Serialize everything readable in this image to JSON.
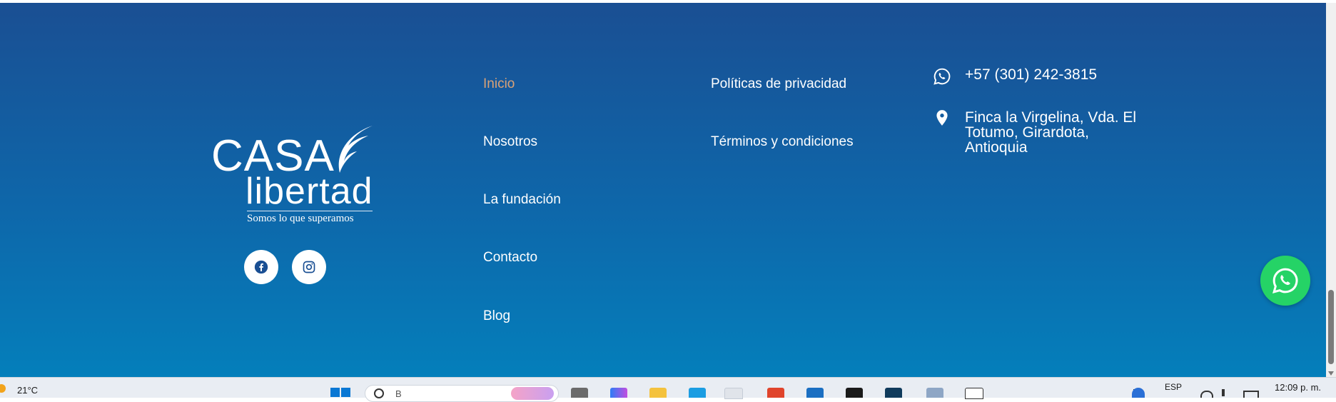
{
  "logo": {
    "line1": "CASA",
    "line2": "libertad",
    "tagline": "Somos lo que superamos"
  },
  "social": [
    {
      "name": "facebook-icon"
    },
    {
      "name": "instagram-icon"
    }
  ],
  "nav": {
    "col1": [
      "Inicio",
      "Nosotros",
      "La fundación",
      "Contacto",
      "Blog"
    ],
    "col2": [
      "Políticas de privacidad",
      "Términos y condiciones"
    ]
  },
  "contact": {
    "phone": "+57 (301) 242-3815",
    "address_lines": [
      "Finca la Virgelina, Vda. El",
      "Totumo, Girardota,",
      "Antioquia"
    ]
  },
  "colors": {
    "footer_top": "#1a4f93",
    "footer_bottom": "#047fbb",
    "active_link": "#d9a277",
    "whatsapp": "#25d366"
  },
  "taskbar": {
    "weather": "21°C",
    "search_placeholder": "B",
    "language": "ESP",
    "time": "12:09 p. m."
  }
}
